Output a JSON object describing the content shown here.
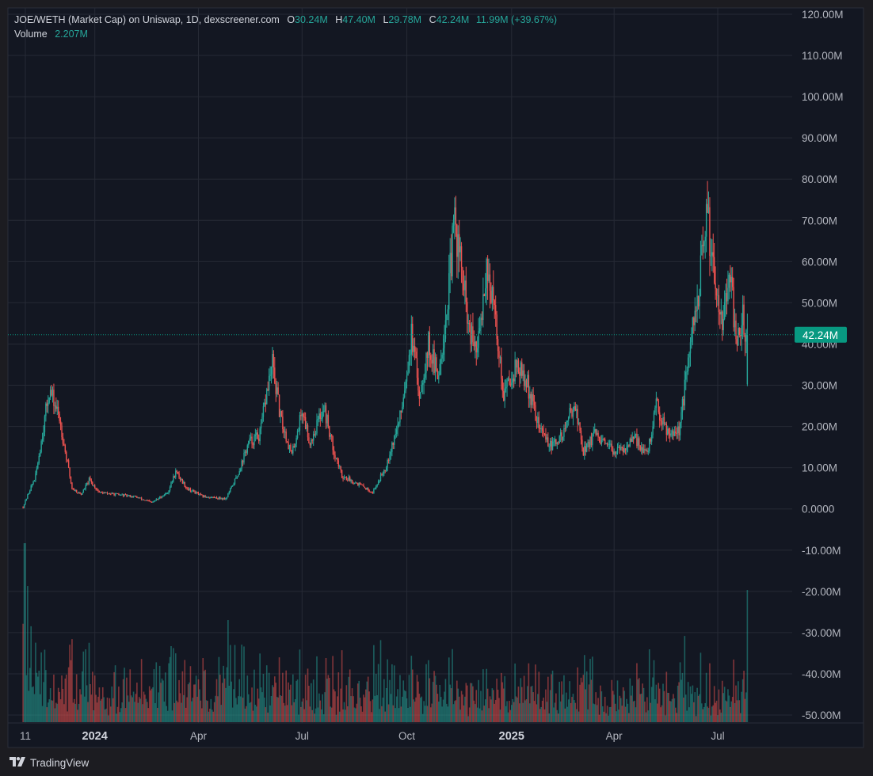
{
  "header": {
    "title": "JOE/WETH (Market Cap) on Uniswap, 1D, dexscreener.com",
    "open_label": "O",
    "open": "30.24M",
    "high_label": "H",
    "high": "47.40M",
    "low_label": "L",
    "low": "29.78M",
    "close_label": "C",
    "close": "42.24M",
    "change": "11.99M (+39.67%)",
    "volume_label": "Volume",
    "volume": "2.207M"
  },
  "branding": {
    "name": "TradingView"
  },
  "colors": {
    "up": "#26a69a",
    "down": "#ef5350",
    "background": "#131722",
    "grid": "#262a35",
    "price_tag": "#089981"
  },
  "chart_data": {
    "type": "candlestick",
    "title": "JOE/WETH (Market Cap) on Uniswap, 1D, dexscreener.com",
    "interval": "1D",
    "ylim": [
      -52000000,
      122000000
    ],
    "y_ticks": [
      "120.00M",
      "110.00M",
      "100.00M",
      "90.00M",
      "80.00M",
      "70.00M",
      "60.00M",
      "50.00M",
      "40.00M",
      "30.00M",
      "20.00M",
      "10.00M",
      "0.0000",
      "-10.00M",
      "-20.00M",
      "-30.00M",
      "-40.00M",
      "-50.00M"
    ],
    "x_ticks": [
      {
        "label": "11",
        "date": "2023-11-01",
        "bold": false
      },
      {
        "label": "2024",
        "date": "2024-01-01",
        "bold": true
      },
      {
        "label": "Apr",
        "date": "2024-04-01",
        "bold": false
      },
      {
        "label": "Jul",
        "date": "2024-07-01",
        "bold": false
      },
      {
        "label": "Oct",
        "date": "2024-10-01",
        "bold": false
      },
      {
        "label": "2025",
        "date": "2025-01-01",
        "bold": true
      },
      {
        "label": "Apr",
        "date": "2025-04-01",
        "bold": false
      },
      {
        "label": "Jul",
        "date": "2025-07-01",
        "bold": false
      }
    ],
    "last_price": 42240000,
    "last_price_label": "42.24M",
    "legend": "top-left",
    "grid": true,
    "series": [
      {
        "date": "2023-10-30",
        "close": 0.5
      },
      {
        "date": "2023-11-04",
        "close": 4
      },
      {
        "date": "2023-11-10",
        "close": 8
      },
      {
        "date": "2023-11-17",
        "close": 20
      },
      {
        "date": "2023-11-22",
        "close": 29
      },
      {
        "date": "2023-11-26",
        "close": 26
      },
      {
        "date": "2023-12-01",
        "close": 22
      },
      {
        "date": "2023-12-06",
        "close": 14
      },
      {
        "date": "2023-12-12",
        "close": 5
      },
      {
        "date": "2023-12-20",
        "close": 3.5
      },
      {
        "date": "2023-12-27",
        "close": 7
      },
      {
        "date": "2024-01-05",
        "close": 4
      },
      {
        "date": "2024-01-20",
        "close": 3.5
      },
      {
        "date": "2024-02-05",
        "close": 3
      },
      {
        "date": "2024-02-20",
        "close": 1.5
      },
      {
        "date": "2024-03-05",
        "close": 4
      },
      {
        "date": "2024-03-12",
        "close": 9
      },
      {
        "date": "2024-03-22",
        "close": 5
      },
      {
        "date": "2024-04-05",
        "close": 3
      },
      {
        "date": "2024-04-25",
        "close": 2.5
      },
      {
        "date": "2024-05-05",
        "close": 8
      },
      {
        "date": "2024-05-15",
        "close": 16
      },
      {
        "date": "2024-05-25",
        "close": 18
      },
      {
        "date": "2024-06-01",
        "close": 30
      },
      {
        "date": "2024-06-05",
        "close": 35
      },
      {
        "date": "2024-06-12",
        "close": 22
      },
      {
        "date": "2024-06-22",
        "close": 13
      },
      {
        "date": "2024-07-01",
        "close": 24
      },
      {
        "date": "2024-07-08",
        "close": 16
      },
      {
        "date": "2024-07-20",
        "close": 25
      },
      {
        "date": "2024-07-28",
        "close": 15
      },
      {
        "date": "2024-08-05",
        "close": 8
      },
      {
        "date": "2024-08-20",
        "close": 6
      },
      {
        "date": "2024-09-01",
        "close": 4
      },
      {
        "date": "2024-09-12",
        "close": 10
      },
      {
        "date": "2024-09-25",
        "close": 22
      },
      {
        "date": "2024-10-05",
        "close": 42
      },
      {
        "date": "2024-10-12",
        "close": 28
      },
      {
        "date": "2024-10-20",
        "close": 40
      },
      {
        "date": "2024-10-28",
        "close": 32
      },
      {
        "date": "2024-11-05",
        "close": 48
      },
      {
        "date": "2024-11-12",
        "close": 70
      },
      {
        "date": "2024-11-18",
        "close": 58
      },
      {
        "date": "2024-11-25",
        "close": 42
      },
      {
        "date": "2024-12-02",
        "close": 38
      },
      {
        "date": "2024-12-10",
        "close": 60
      },
      {
        "date": "2024-12-18",
        "close": 45
      },
      {
        "date": "2024-12-25",
        "close": 28
      },
      {
        "date": "2025-01-05",
        "close": 35
      },
      {
        "date": "2025-01-15",
        "close": 30
      },
      {
        "date": "2025-01-25",
        "close": 20
      },
      {
        "date": "2025-02-05",
        "close": 15
      },
      {
        "date": "2025-02-15",
        "close": 18
      },
      {
        "date": "2025-02-25",
        "close": 26
      },
      {
        "date": "2025-03-05",
        "close": 14
      },
      {
        "date": "2025-03-15",
        "close": 18
      },
      {
        "date": "2025-03-25",
        "close": 15
      },
      {
        "date": "2025-04-05",
        "close": 14
      },
      {
        "date": "2025-04-20",
        "close": 17
      },
      {
        "date": "2025-04-30",
        "close": 13
      },
      {
        "date": "2025-05-08",
        "close": 25
      },
      {
        "date": "2025-05-18",
        "close": 19
      },
      {
        "date": "2025-05-28",
        "close": 19
      },
      {
        "date": "2025-06-05",
        "close": 35
      },
      {
        "date": "2025-06-15",
        "close": 55
      },
      {
        "date": "2025-06-22",
        "close": 72
      },
      {
        "date": "2025-06-28",
        "close": 57
      },
      {
        "date": "2025-07-05",
        "close": 47
      },
      {
        "date": "2025-07-12",
        "close": 55
      },
      {
        "date": "2025-07-18",
        "close": 40
      },
      {
        "date": "2025-07-23",
        "close": 46
      },
      {
        "date": "2025-07-27",
        "close": 42.24
      }
    ]
  }
}
